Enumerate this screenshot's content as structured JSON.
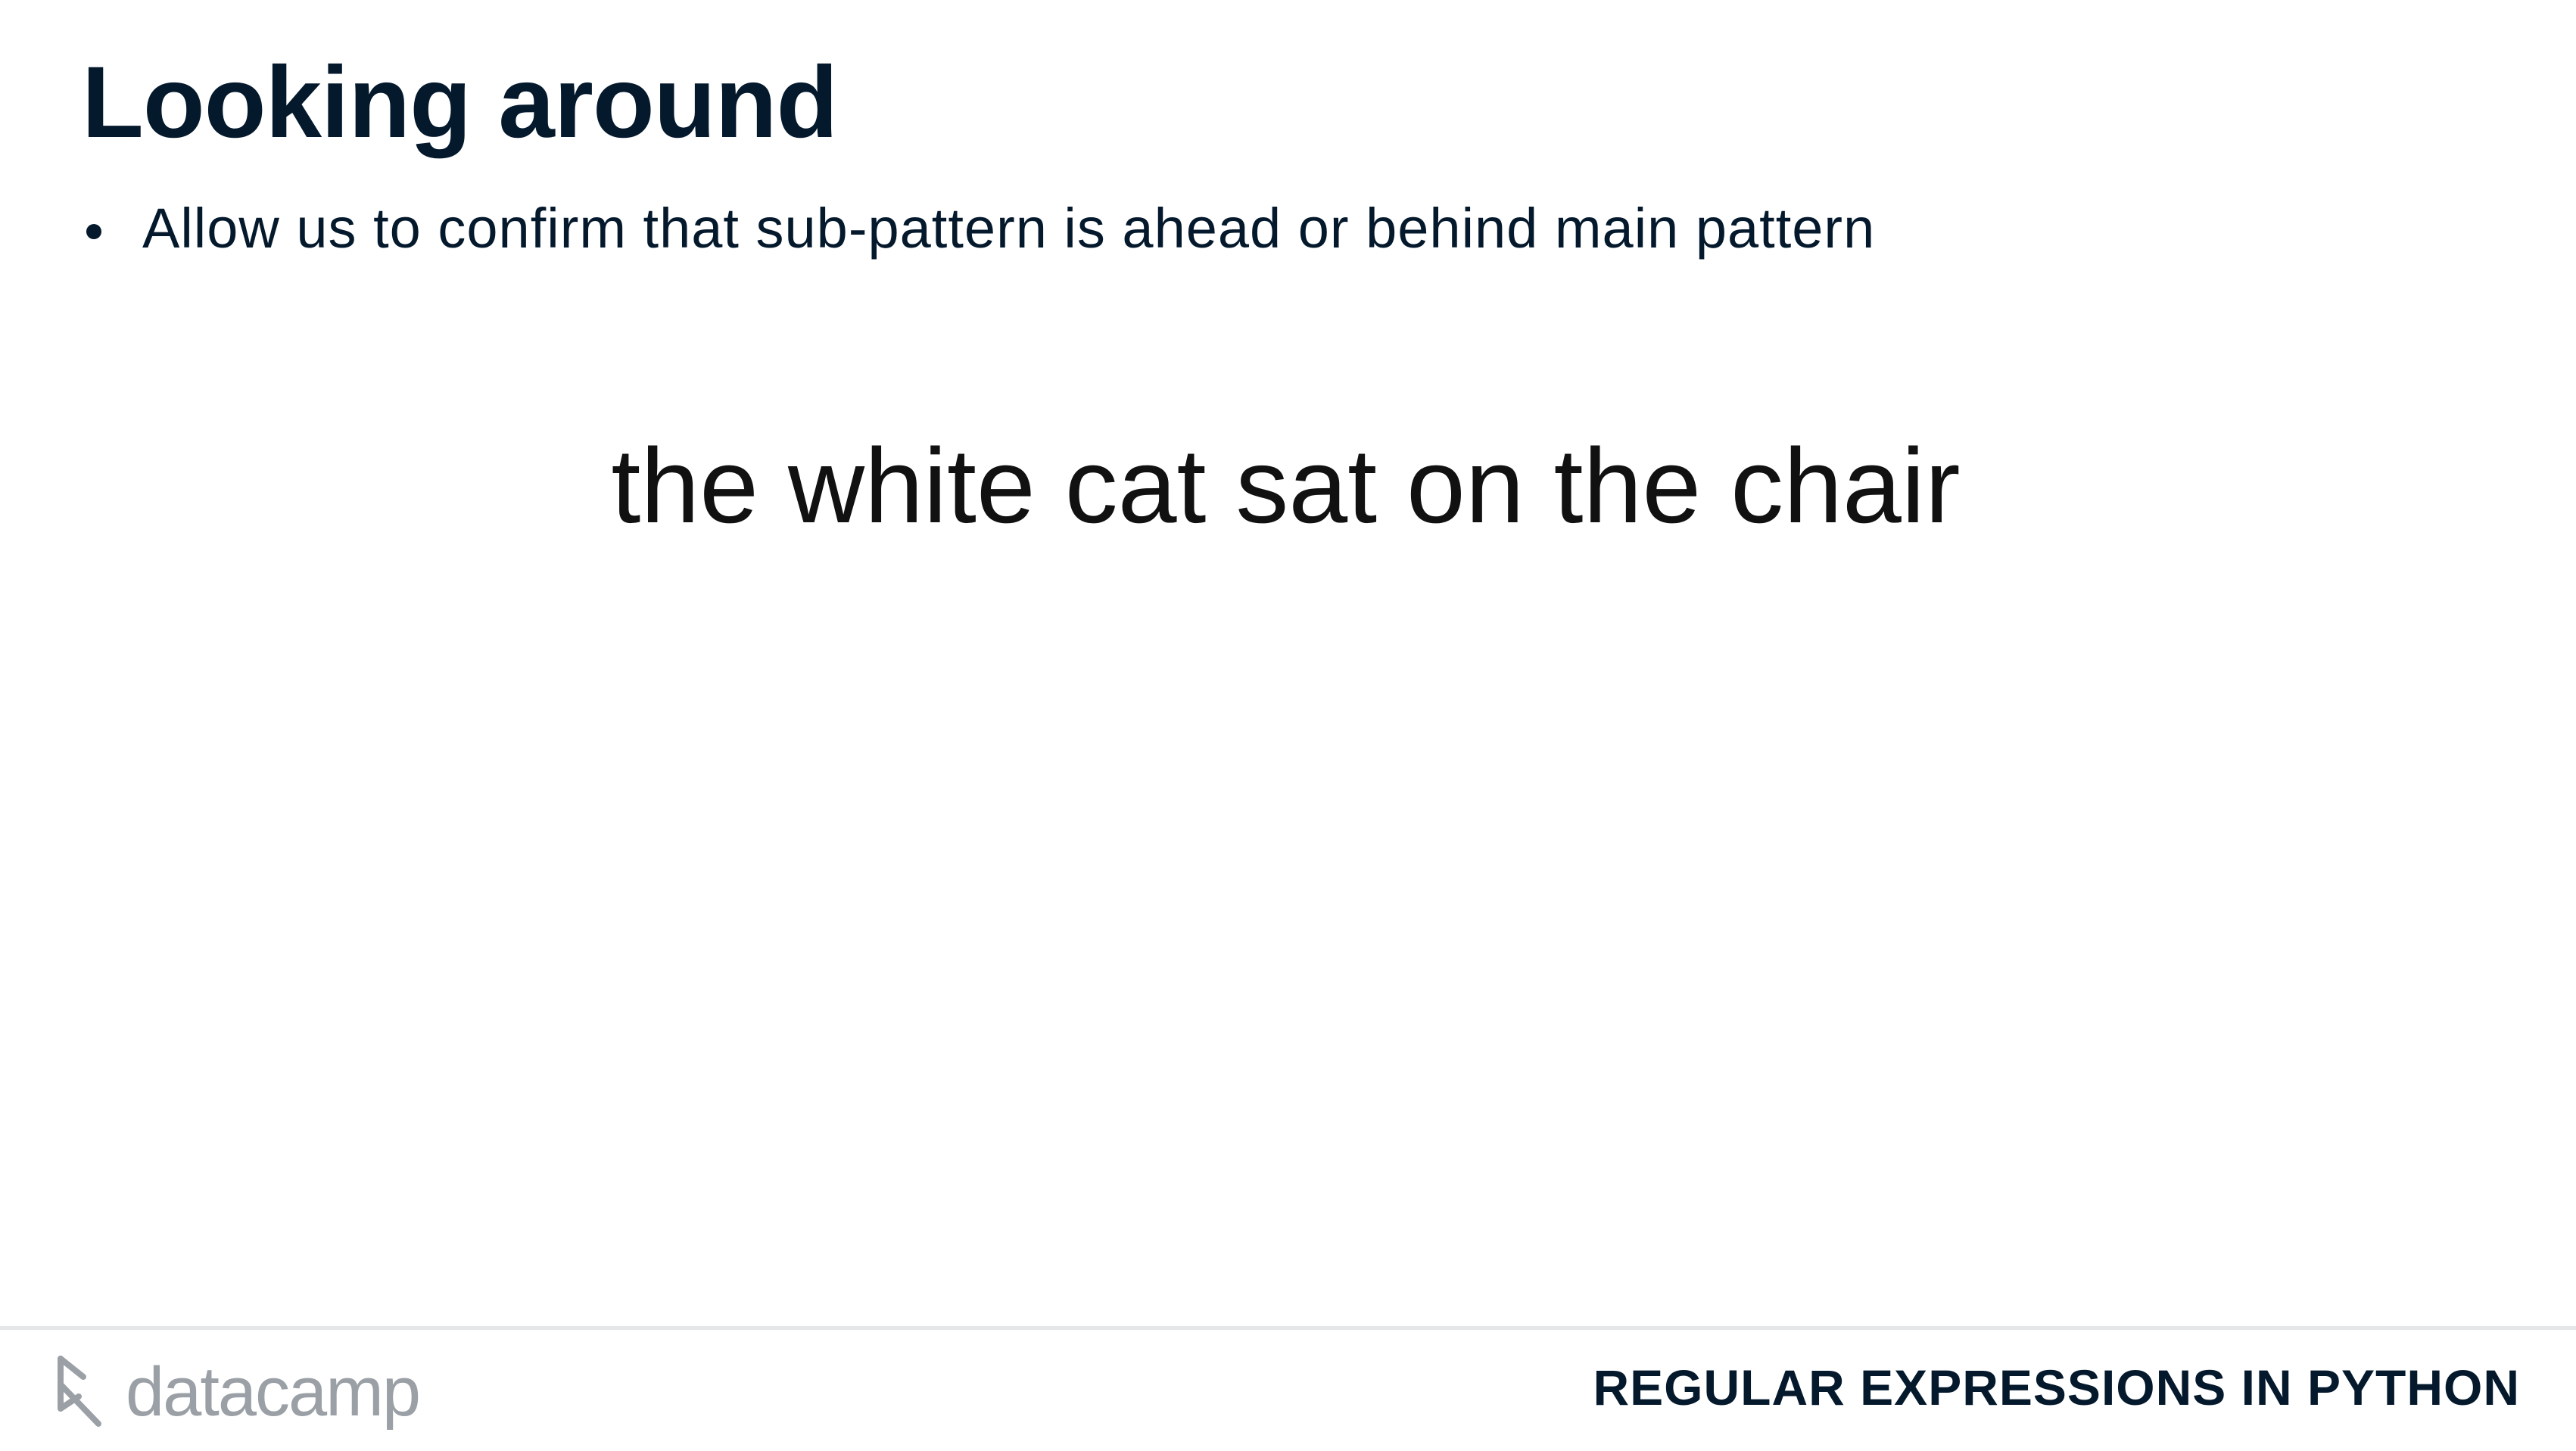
{
  "slide": {
    "title": "Looking around",
    "bullets": [
      "Allow us to confirm that sub-pattern is ahead or behind main pattern"
    ],
    "example_text": "the white cat sat on the chair"
  },
  "footer": {
    "logo_text": "datacamp",
    "course_name": "REGULAR EXPRESSIONS IN PYTHON",
    "logo_icon": "datacamp-logo-icon"
  },
  "colors": {
    "text_dark": "#05192d",
    "logo_gray": "#9aa0a6",
    "divider": "#e6e7e8"
  }
}
